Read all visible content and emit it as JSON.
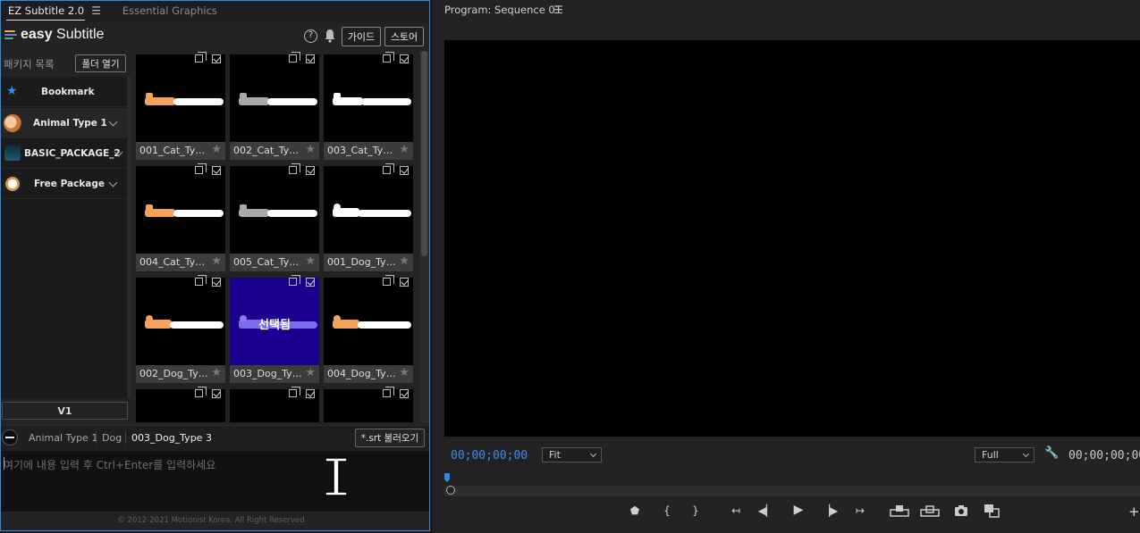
{
  "tabs": {
    "active": "EZ Subtitle 2.0",
    "inactive": "Essential Graphics"
  },
  "brand": {
    "strong": "easy",
    "rest": " Subtitle"
  },
  "header": {
    "help": "?",
    "guide_label": "가이드",
    "store_label": "스토어"
  },
  "sidebar": {
    "title": "패키지 목록",
    "folder_button": "폴더 열기",
    "items": [
      {
        "label": "Bookmark"
      },
      {
        "label": "Animal Type 1"
      },
      {
        "label": "BASIC_PACKAGE_2"
      },
      {
        "label": "Free Package"
      }
    ],
    "track_button": "V1"
  },
  "grid": {
    "cards": [
      {
        "name": "001_Cat_Ty…"
      },
      {
        "name": "002_Cat_Ty…"
      },
      {
        "name": "003_Cat_Ty…"
      },
      {
        "name": "004_Cat_Ty…"
      },
      {
        "name": "005_Cat_Ty…"
      },
      {
        "name": "001_Dog_Ty…"
      },
      {
        "name": "002_Dog_Ty…"
      },
      {
        "name": "003_Dog_Ty…"
      },
      {
        "name": "004_Dog_Ty…"
      }
    ],
    "selected_overlay": "선택됨"
  },
  "breadcrumb": {
    "package": "Animal Type 1",
    "category": "Dog",
    "item": "003_Dog_Type 3",
    "srt_button": "*.srt 불러오기"
  },
  "editor": {
    "placeholder": "여기에 내용 입력 후 Ctrl+Enter를 입력하세요"
  },
  "footer": {
    "copyright": "© 2012-2021 Motionist Korea. All Right Reserved"
  },
  "program": {
    "title": "Program: Sequence 01",
    "timecode_current": "00;00;00;00",
    "timecode_duration": "00;00;00;00",
    "zoom": "Fit",
    "resolution": "Full"
  },
  "controls": {
    "marker": "⬟",
    "mark_in": "{",
    "mark_out": "}",
    "go_in": "↤",
    "step_back": "◀▏",
    "play": "▶",
    "step_forward": "▕▶",
    "go_out": "↦",
    "plus": "+"
  },
  "colors": {
    "accent": "#2d8ceb",
    "selected_thumb": "#1b0090",
    "cat_orange": "#f5a35c",
    "cat_gray": "#a9a9a9"
  }
}
